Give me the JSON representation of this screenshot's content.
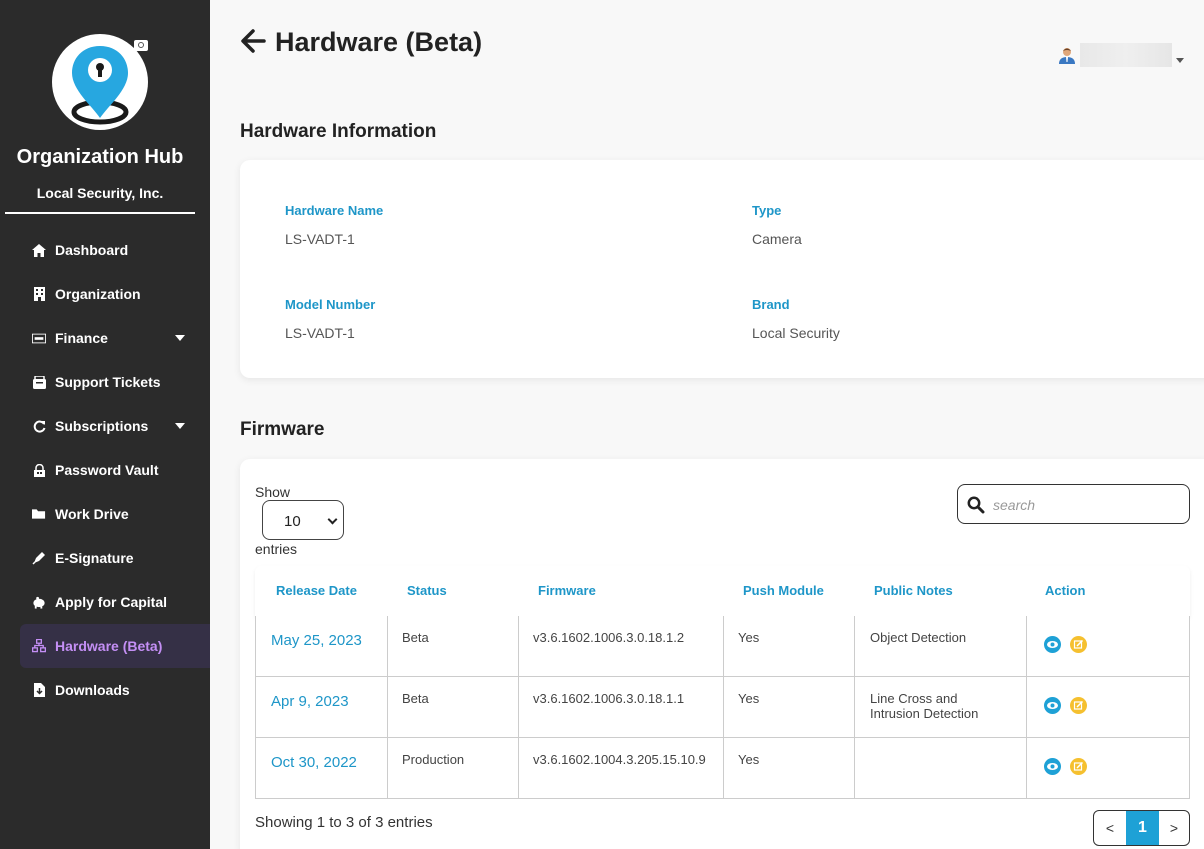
{
  "sidebar": {
    "org_name": "Organization Hub",
    "org_sub": "Local Security, Inc.",
    "items": [
      {
        "label": "Dashboard",
        "icon": "home-icon"
      },
      {
        "label": "Organization",
        "icon": "building-icon"
      },
      {
        "label": "Finance",
        "icon": "money-bill-icon",
        "expandable": true
      },
      {
        "label": "Support Tickets",
        "icon": "ticket-icon"
      },
      {
        "label": "Subscriptions",
        "icon": "refresh-icon",
        "expandable": true
      },
      {
        "label": "Password Vault",
        "icon": "vault-icon"
      },
      {
        "label": "Work Drive",
        "icon": "folder-icon"
      },
      {
        "label": "E-Signature",
        "icon": "pen-icon"
      },
      {
        "label": "Apply for Capital",
        "icon": "piggy-bank-icon"
      },
      {
        "label": "Hardware (Beta)",
        "icon": "network-icon",
        "active": true
      },
      {
        "label": "Downloads",
        "icon": "download-file-icon"
      }
    ]
  },
  "header": {
    "title": "Hardware (Beta)"
  },
  "hardware_info": {
    "section_title": "Hardware Information",
    "name_label": "Hardware Name",
    "name_value": "LS-VADT-1",
    "type_label": "Type",
    "type_value": "Camera",
    "model_label": "Model Number",
    "model_value": "LS-VADT-1",
    "brand_label": "Brand",
    "brand_value": "Local Security"
  },
  "firmware": {
    "section_title": "Firmware",
    "show_label": "Show",
    "page_size": "10",
    "entries_label": "entries",
    "search_placeholder": "search",
    "columns": [
      "Release Date",
      "Status",
      "Firmware",
      "Push Module",
      "Public Notes",
      "Action"
    ],
    "rows": [
      {
        "date": "May 25, 2023",
        "status": "Beta",
        "firmware": "v3.6.1602.1006.3.0.18.1.2",
        "push": "Yes",
        "notes_1": "Object Detection",
        "notes_2": ""
      },
      {
        "date": "Apr 9, 2023",
        "status": "Beta",
        "firmware": "v3.6.1602.1006.3.0.18.1.1",
        "push": "Yes",
        "notes_1": "Line Cross and",
        "notes_2": "Intrusion Detection"
      },
      {
        "date": "Oct 30, 2022",
        "status": "Production",
        "firmware": "v3.6.1602.1004.3.205.15.10.9",
        "push": "Yes",
        "notes_1": "",
        "notes_2": ""
      }
    ],
    "summary": "Showing 1 to 3 of 3 entries",
    "pager": {
      "prev": "<",
      "current": "1",
      "next": ">"
    }
  },
  "colors": {
    "accent": "#1e96c8",
    "sidebar_bg": "#2b2b2b",
    "active_item": "#c48ff5",
    "edit_icon": "#f5c02f"
  }
}
